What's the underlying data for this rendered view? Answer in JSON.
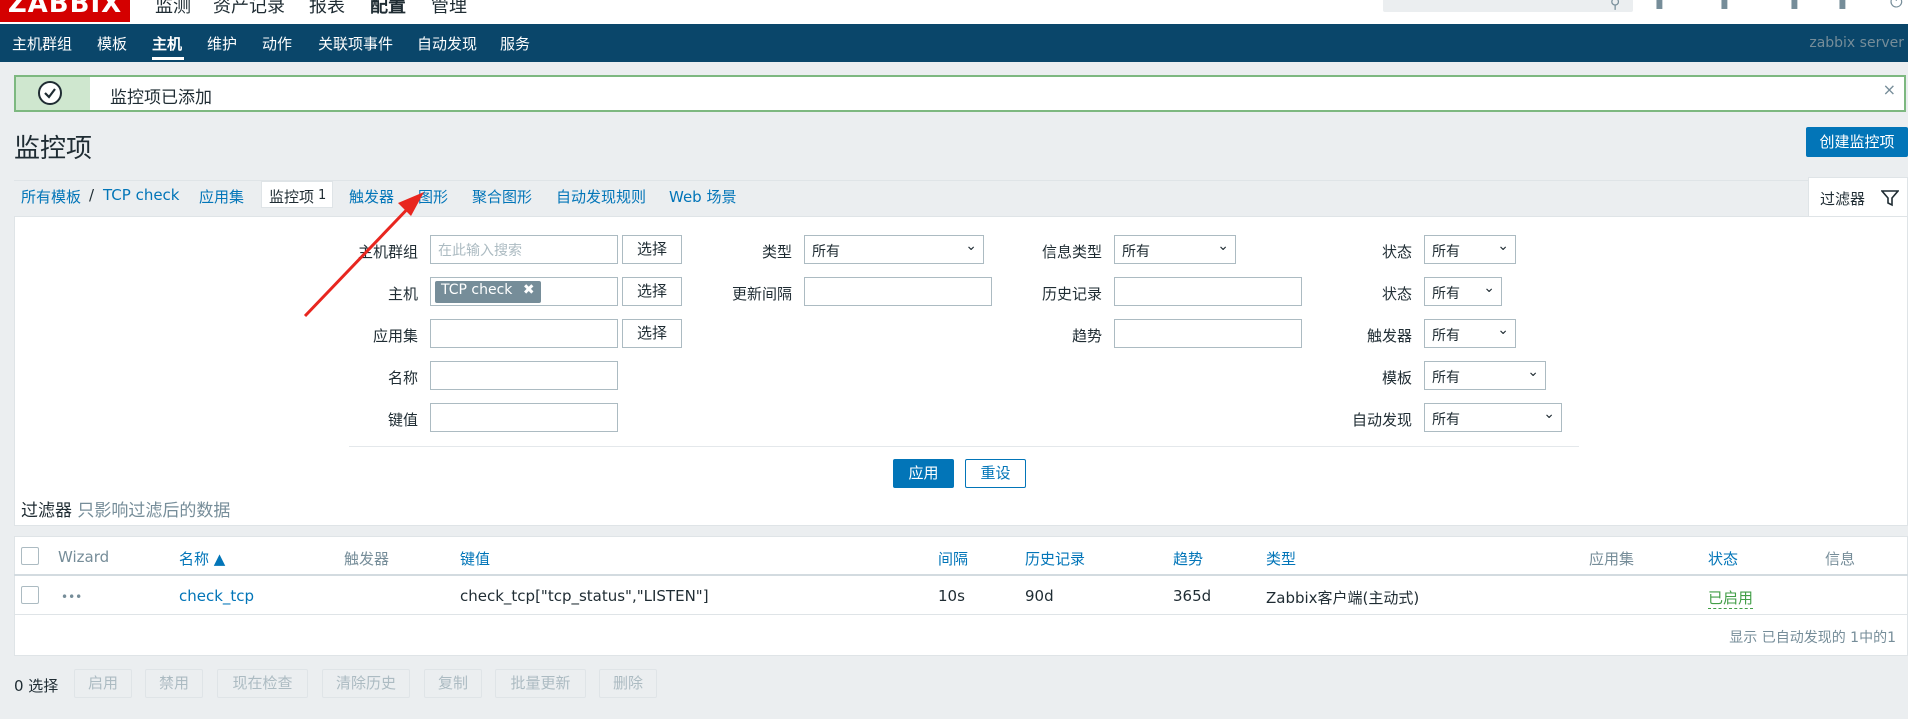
{
  "header": {
    "logo": "ZABBIX",
    "menu": [
      "监测",
      "资产记录",
      "报表",
      "配置",
      "管理"
    ],
    "active_menu": "配置"
  },
  "subnav": {
    "items": [
      "主机群组",
      "模板",
      "主机",
      "维护",
      "动作",
      "关联项事件",
      "自动发现",
      "服务"
    ],
    "active": "主机",
    "server_name": "zabbix server"
  },
  "message": {
    "text": "监控项已添加",
    "close": "×"
  },
  "page": {
    "title": "监控项",
    "create_button": "创建监控项"
  },
  "breadcrumb": {
    "all_templates": "所有模板",
    "separator": "/",
    "template": "TCP check",
    "tabs": [
      {
        "label": "应用集"
      },
      {
        "label": "监控项",
        "count": "1"
      },
      {
        "label": "触发器"
      },
      {
        "label": "图形"
      },
      {
        "label": "聚合图形"
      },
      {
        "label": "自动发现规则"
      },
      {
        "label": "Web 场景"
      }
    ]
  },
  "filter_tab": {
    "label": "过滤器",
    "icon": "filter-icon"
  },
  "filter": {
    "host_group": {
      "label": "主机群组",
      "placeholder": "在此输入搜索",
      "button": "选择"
    },
    "host": {
      "label": "主机",
      "tag": "TCP check",
      "tag_remove": "✖",
      "button": "选择"
    },
    "application": {
      "label": "应用集",
      "button": "选择"
    },
    "name": {
      "label": "名称"
    },
    "key": {
      "label": "键值"
    },
    "type": {
      "label": "类型",
      "value": "所有"
    },
    "update_interval": {
      "label": "更新间隔"
    },
    "info_type": {
      "label": "信息类型",
      "value": "所有"
    },
    "history": {
      "label": "历史记录"
    },
    "trends": {
      "label": "趋势"
    },
    "state": {
      "label": "状态",
      "value": "所有"
    },
    "status": {
      "label": "状态",
      "value": "所有"
    },
    "triggers": {
      "label": "触发器",
      "value": "所有"
    },
    "template": {
      "label": "模板",
      "value": "所有"
    },
    "discovery": {
      "label": "自动发现",
      "value": "所有"
    },
    "apply": "应用",
    "reset": "重设",
    "note_label": "过滤器",
    "note_text": "只影响过滤后的数据"
  },
  "table": {
    "headers": {
      "wizard": "Wizard",
      "name": "名称 ▲",
      "triggers": "触发器",
      "key": "键值",
      "interval": "间隔",
      "history": "历史记录",
      "trends": "趋势",
      "type": "类型",
      "applications": "应用集",
      "status": "状态",
      "info": "信息"
    },
    "rows": [
      {
        "wizard": "•••",
        "name": "check_tcp",
        "key": "check_tcp[\"tcp_status\",\"LISTEN\"]",
        "interval": "10s",
        "history": "90d",
        "trends": "365d",
        "type": "Zabbix客户端(主动式)",
        "status": "已启用"
      }
    ],
    "footer": "显示 已自动发现的 1中的1"
  },
  "actions": {
    "selected": "0 选择",
    "buttons": [
      "启用",
      "禁用",
      "现在检查",
      "清除历史",
      "复制",
      "批量更新",
      "删除"
    ]
  },
  "colors": {
    "nav": "#0a466a",
    "link": "#0275b8",
    "success": "#7db880",
    "enabled": "#429e47",
    "annotation": "#e8261f"
  }
}
